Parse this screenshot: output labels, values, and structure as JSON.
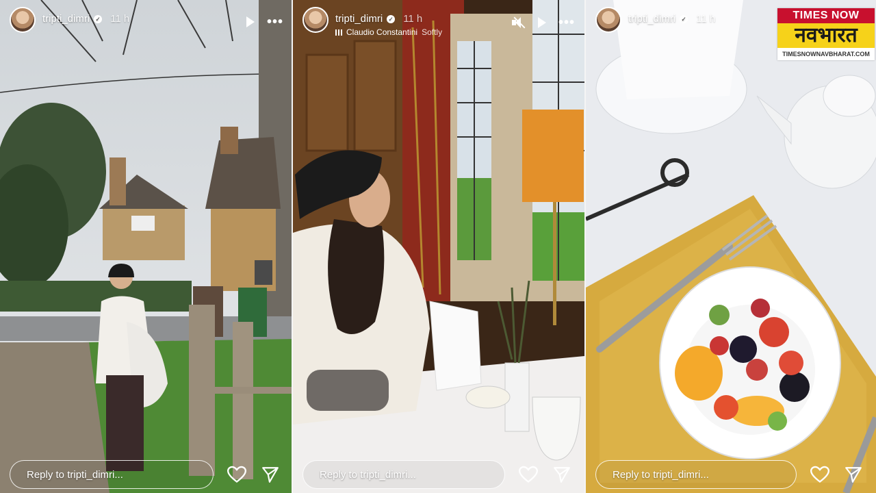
{
  "stories": [
    {
      "username": "tripti_dimri",
      "time": "11 h",
      "reply_placeholder": "Reply to tripti_dimri..."
    },
    {
      "username": "tripti_dimri",
      "time": "11 h",
      "music_artist": "Claudio Constantini",
      "music_track": "Softly",
      "reply_placeholder": "Reply to tripti_dimri..."
    },
    {
      "username": "tripti_dimri",
      "time": "11 h",
      "reply_placeholder": "Reply to tripti_dimri..."
    }
  ],
  "brand": {
    "top": "TIMES NOW",
    "middle": "नवभारत",
    "bottom": "TIMESNOWNAVBHARAT.COM"
  },
  "icons": [
    "play-icon",
    "more-icon",
    "mute-icon",
    "heart-icon",
    "send-icon",
    "verified-icon"
  ]
}
